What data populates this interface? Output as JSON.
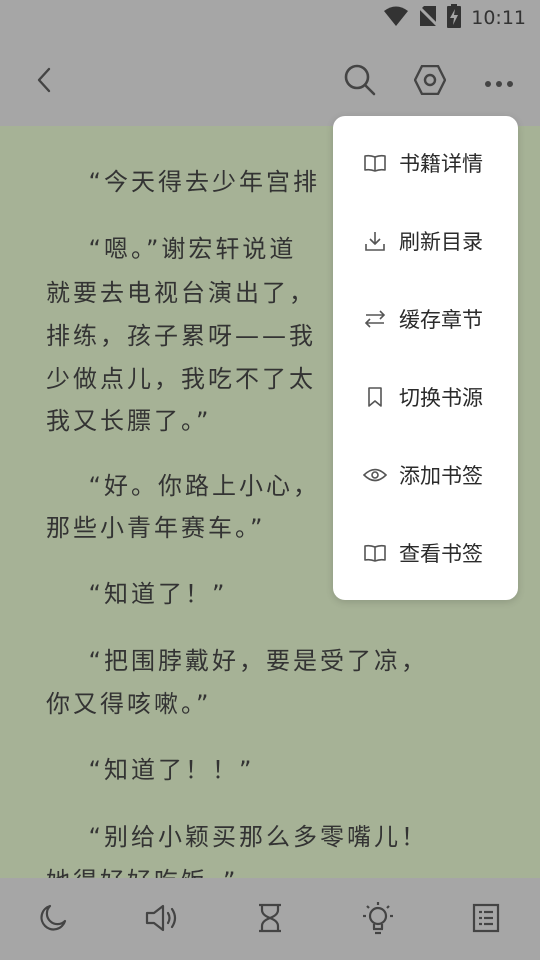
{
  "status_bar": {
    "time": "10:11",
    "icons": [
      "wifi-icon",
      "no-sim-icon",
      "battery-charging-icon"
    ]
  },
  "toolbar": {
    "icons": [
      "back-icon",
      "search-icon",
      "settings-icon",
      "more-icon"
    ]
  },
  "reader": {
    "paragraphs": [
      "    “今天得去少年宫排",
      "    “嗯。”谢宏轩说道",
      "就要去电视台演出了，",
      "排练，孩子累呀——我",
      "少做点儿，我吃不了太",
      "我又长膘了。”",
      "    “好。你路上小心，",
      "那些小青年赛车。”",
      "    “知道了！”",
      "    “把围脖戴好，要是受了凉，",
      "你又得咳嗽。”",
      "    “知道了！！”",
      "    “别给小颖买那么多零嘴儿！",
      "她得好好吃饭。”"
    ]
  },
  "menu": {
    "items": [
      {
        "label": "书籍详情",
        "icon": "book-open-icon"
      },
      {
        "label": "刷新目录",
        "icon": "download-icon"
      },
      {
        "label": "缓存章节",
        "icon": "swap-arrows-icon"
      },
      {
        "label": "切换书源",
        "icon": "bookmark-icon"
      },
      {
        "label": "添加书签",
        "icon": "eye-icon"
      },
      {
        "label": "查看书签",
        "icon": "book-open-icon"
      }
    ]
  },
  "bottom_bar": {
    "icons": [
      "moon-icon",
      "speaker-icon",
      "hourglass-icon",
      "lightbulb-icon",
      "list-icon"
    ]
  },
  "colors": {
    "reader_background": "#a6b296",
    "bars": "#a6a6a6",
    "text": "#333333",
    "menu_background": "#ffffff"
  }
}
